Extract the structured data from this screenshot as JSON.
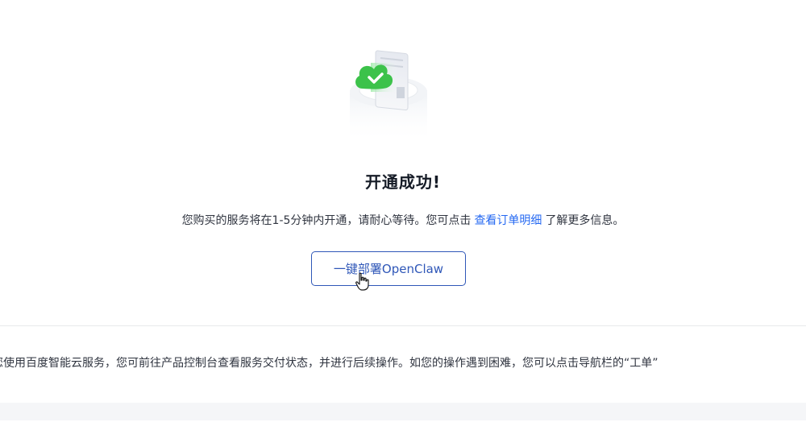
{
  "success": {
    "title": "开通成功!",
    "desc_before": "您购买的服务将在1-5分钟内开通，请耐心等待。您可点击",
    "link_label": "查看订单明细",
    "desc_after": "了解更多信息。",
    "deploy_button_label": "一键部署OpenClaw",
    "illustration_icon": "cloud-check-icon",
    "accent_color": "#2468f2",
    "success_color": "#3cc24a"
  },
  "notice": {
    "text": "您使用百度智能云服务，您可前往产品控制台查看服务交付状态，并进行后续操作。如您的操作遇到困难，您可以点击导航栏的“工单”"
  }
}
